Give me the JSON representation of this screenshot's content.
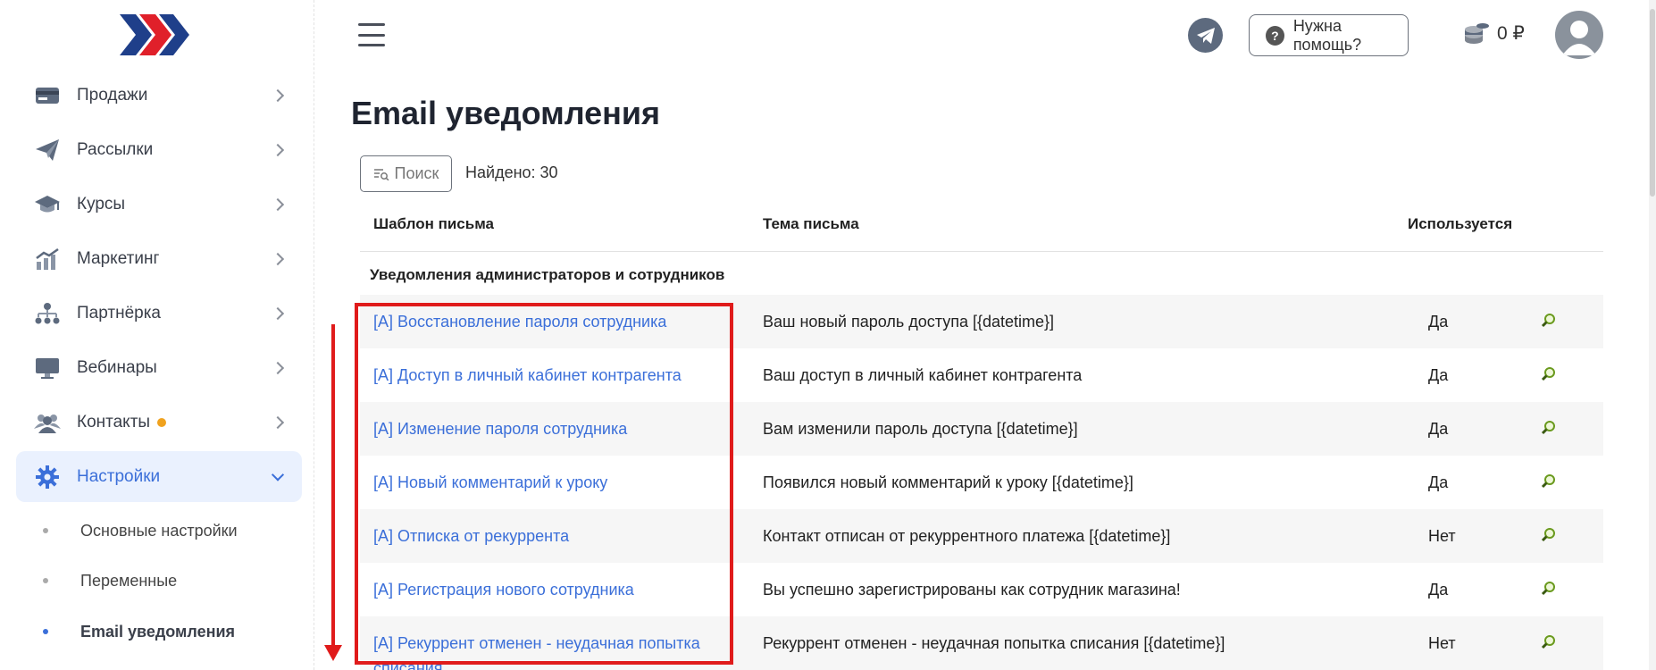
{
  "sidebar": {
    "items": [
      {
        "label": "Продажи"
      },
      {
        "label": "Рассылки"
      },
      {
        "label": "Курсы"
      },
      {
        "label": "Маркетинг"
      },
      {
        "label": "Партнёрка"
      },
      {
        "label": "Вебинары"
      },
      {
        "label": "Контакты"
      },
      {
        "label": "Настройки"
      }
    ],
    "subitems": [
      {
        "label": "Основные настройки"
      },
      {
        "label": "Переменные"
      },
      {
        "label": "Email уведомления"
      }
    ]
  },
  "header": {
    "help_label": "Нужна помощь?",
    "balance": "0 ₽"
  },
  "main": {
    "title": "Email уведомления",
    "search_label": "Поиск",
    "found": "Найдено: 30",
    "columns": {
      "template": "Шаблон письма",
      "subject": "Тема письма",
      "used": "Используется"
    },
    "group": "Уведомления администраторов и сотрудников",
    "rows": [
      {
        "template": "[A] Восстановление пароля сотрудника",
        "subject": "Ваш новый пароль доступа [{datetime}]",
        "used": "Да"
      },
      {
        "template": "[A] Доступ в личный кабинет контрагента",
        "subject": "Ваш доступ в личный кабинет контрагента",
        "used": "Да"
      },
      {
        "template": "[A] Изменение пароля сотрудника",
        "subject": "Вам изменили пароль доступа [{datetime}]",
        "used": "Да"
      },
      {
        "template": "[A] Новый комментарий к уроку",
        "subject": "Появился новый комментарий к уроку [{datetime}]",
        "used": "Да"
      },
      {
        "template": "[A] Отписка от рекуррента",
        "subject": "Контакт отписан от рекуррентного платежа [{datetime}]",
        "used": "Нет"
      },
      {
        "template": "[A] Регистрация нового сотрудника",
        "subject": "Вы успешно зарегистрированы как сотрудник магазина!",
        "used": "Да"
      },
      {
        "template": "[A] Рекуррент отменен - неудачная попытка",
        "subject": "Рекуррент отменен - неудачная попытка списания [{datetime}]",
        "used": "Нет"
      }
    ],
    "row_partial": "списания"
  },
  "colors": {
    "accent": "#3b6fd9",
    "annotation": "#e01b1b",
    "badge": "#f0a21e"
  }
}
